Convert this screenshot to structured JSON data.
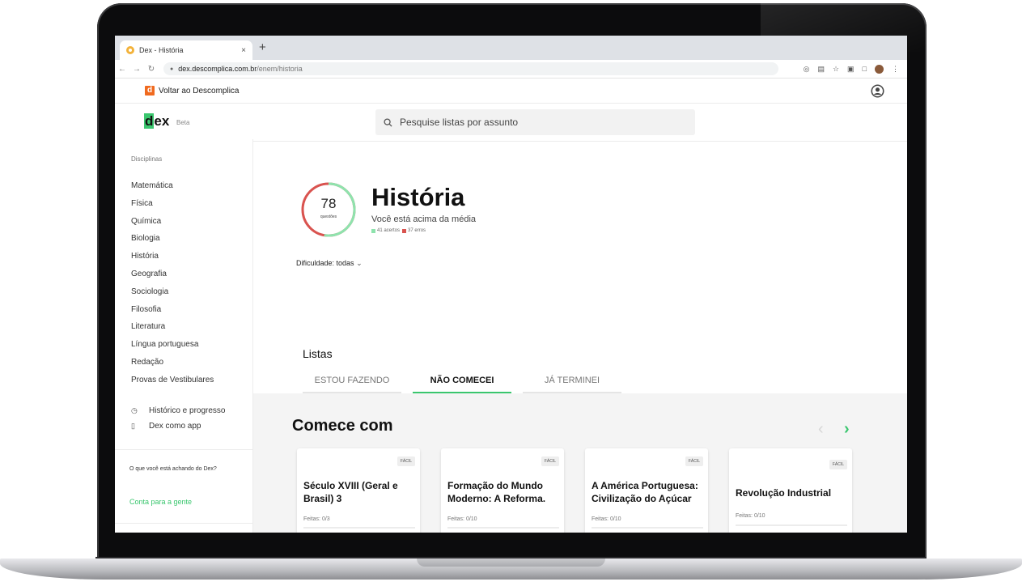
{
  "browser": {
    "tab_title": "Dex - História",
    "tab_close": "×",
    "new_tab": "+",
    "url_domain": "dex.descomplica.com.br",
    "url_path": "/enem/historia"
  },
  "top_strip": {
    "logo_letter": "d",
    "back_label": "Voltar ao Descomplica"
  },
  "header": {
    "logo_d": "d",
    "logo_rest": "ex",
    "beta": "Beta",
    "search_placeholder": "Pesquise listas por assunto"
  },
  "sidebar": {
    "title": "Disciplinas",
    "items": [
      "Matemática",
      "Física",
      "Química",
      "Biologia",
      "História",
      "Geografia",
      "Sociologia",
      "Filosofia",
      "Literatura",
      "Língua portuguesa",
      "Redação",
      "Provas de Vestibulares"
    ],
    "history_label": "Histórico e progresso",
    "app_label": "Dex como app",
    "feedback_text": "O que você está achando do Dex?",
    "feedback_link": "Conta para a gente"
  },
  "subject": {
    "questions": "78",
    "questions_label": "questões",
    "title": "História",
    "status": "Você está acima da média",
    "correct": "41 acertos",
    "wrong": "37 erros",
    "correct_fraction": 0.526,
    "difficulty": "Dificuldade: todas"
  },
  "lists": {
    "title": "Listas",
    "tabs": [
      "ESTOU FAZENDO",
      "NÃO COMECEI",
      "JÁ TERMINEI"
    ],
    "start_title": "Comece com",
    "cards": [
      {
        "badge": "FÁCIL",
        "title": "Século XVIII (Geral e Brasil) 3",
        "done": "Feitas: 0/3"
      },
      {
        "badge": "FÁCIL",
        "title": "Formação do Mundo Moderno: A Reforma.",
        "done": "Feitas: 0/10"
      },
      {
        "badge": "FÁCIL",
        "title": "A América Portuguesa: Civilização do Açúcar",
        "done": "Feitas: 0/10"
      },
      {
        "badge": "FÁCIL",
        "title": "Revolução Industrial",
        "done": "Feitas: 0/10"
      }
    ]
  },
  "colors": {
    "accent": "#3ac66e",
    "error": "#d9534f",
    "brand_orange": "#f06a1f"
  }
}
